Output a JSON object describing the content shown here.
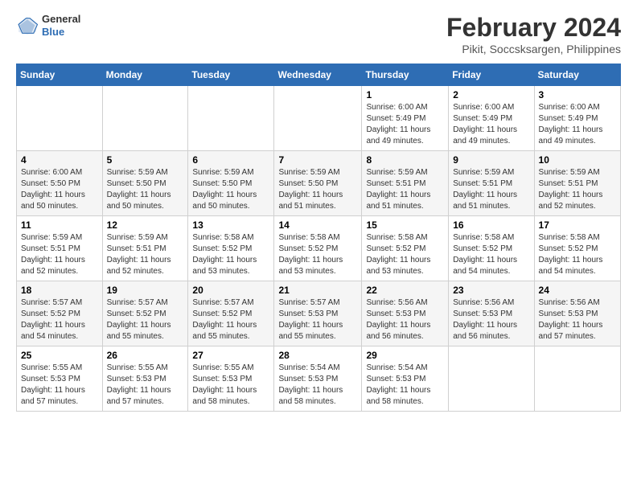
{
  "header": {
    "logo_general": "General",
    "logo_blue": "Blue",
    "month_year": "February 2024",
    "location": "Pikit, Soccsksargen, Philippines"
  },
  "weekdays": [
    "Sunday",
    "Monday",
    "Tuesday",
    "Wednesday",
    "Thursday",
    "Friday",
    "Saturday"
  ],
  "weeks": [
    [
      {
        "day": "",
        "info": ""
      },
      {
        "day": "",
        "info": ""
      },
      {
        "day": "",
        "info": ""
      },
      {
        "day": "",
        "info": ""
      },
      {
        "day": "1",
        "info": "Sunrise: 6:00 AM\nSunset: 5:49 PM\nDaylight: 11 hours\nand 49 minutes."
      },
      {
        "day": "2",
        "info": "Sunrise: 6:00 AM\nSunset: 5:49 PM\nDaylight: 11 hours\nand 49 minutes."
      },
      {
        "day": "3",
        "info": "Sunrise: 6:00 AM\nSunset: 5:49 PM\nDaylight: 11 hours\nand 49 minutes."
      }
    ],
    [
      {
        "day": "4",
        "info": "Sunrise: 6:00 AM\nSunset: 5:50 PM\nDaylight: 11 hours\nand 50 minutes."
      },
      {
        "day": "5",
        "info": "Sunrise: 5:59 AM\nSunset: 5:50 PM\nDaylight: 11 hours\nand 50 minutes."
      },
      {
        "day": "6",
        "info": "Sunrise: 5:59 AM\nSunset: 5:50 PM\nDaylight: 11 hours\nand 50 minutes."
      },
      {
        "day": "7",
        "info": "Sunrise: 5:59 AM\nSunset: 5:50 PM\nDaylight: 11 hours\nand 51 minutes."
      },
      {
        "day": "8",
        "info": "Sunrise: 5:59 AM\nSunset: 5:51 PM\nDaylight: 11 hours\nand 51 minutes."
      },
      {
        "day": "9",
        "info": "Sunrise: 5:59 AM\nSunset: 5:51 PM\nDaylight: 11 hours\nand 51 minutes."
      },
      {
        "day": "10",
        "info": "Sunrise: 5:59 AM\nSunset: 5:51 PM\nDaylight: 11 hours\nand 52 minutes."
      }
    ],
    [
      {
        "day": "11",
        "info": "Sunrise: 5:59 AM\nSunset: 5:51 PM\nDaylight: 11 hours\nand 52 minutes."
      },
      {
        "day": "12",
        "info": "Sunrise: 5:59 AM\nSunset: 5:51 PM\nDaylight: 11 hours\nand 52 minutes."
      },
      {
        "day": "13",
        "info": "Sunrise: 5:58 AM\nSunset: 5:52 PM\nDaylight: 11 hours\nand 53 minutes."
      },
      {
        "day": "14",
        "info": "Sunrise: 5:58 AM\nSunset: 5:52 PM\nDaylight: 11 hours\nand 53 minutes."
      },
      {
        "day": "15",
        "info": "Sunrise: 5:58 AM\nSunset: 5:52 PM\nDaylight: 11 hours\nand 53 minutes."
      },
      {
        "day": "16",
        "info": "Sunrise: 5:58 AM\nSunset: 5:52 PM\nDaylight: 11 hours\nand 54 minutes."
      },
      {
        "day": "17",
        "info": "Sunrise: 5:58 AM\nSunset: 5:52 PM\nDaylight: 11 hours\nand 54 minutes."
      }
    ],
    [
      {
        "day": "18",
        "info": "Sunrise: 5:57 AM\nSunset: 5:52 PM\nDaylight: 11 hours\nand 54 minutes."
      },
      {
        "day": "19",
        "info": "Sunrise: 5:57 AM\nSunset: 5:52 PM\nDaylight: 11 hours\nand 55 minutes."
      },
      {
        "day": "20",
        "info": "Sunrise: 5:57 AM\nSunset: 5:52 PM\nDaylight: 11 hours\nand 55 minutes."
      },
      {
        "day": "21",
        "info": "Sunrise: 5:57 AM\nSunset: 5:53 PM\nDaylight: 11 hours\nand 55 minutes."
      },
      {
        "day": "22",
        "info": "Sunrise: 5:56 AM\nSunset: 5:53 PM\nDaylight: 11 hours\nand 56 minutes."
      },
      {
        "day": "23",
        "info": "Sunrise: 5:56 AM\nSunset: 5:53 PM\nDaylight: 11 hours\nand 56 minutes."
      },
      {
        "day": "24",
        "info": "Sunrise: 5:56 AM\nSunset: 5:53 PM\nDaylight: 11 hours\nand 57 minutes."
      }
    ],
    [
      {
        "day": "25",
        "info": "Sunrise: 5:55 AM\nSunset: 5:53 PM\nDaylight: 11 hours\nand 57 minutes."
      },
      {
        "day": "26",
        "info": "Sunrise: 5:55 AM\nSunset: 5:53 PM\nDaylight: 11 hours\nand 57 minutes."
      },
      {
        "day": "27",
        "info": "Sunrise: 5:55 AM\nSunset: 5:53 PM\nDaylight: 11 hours\nand 58 minutes."
      },
      {
        "day": "28",
        "info": "Sunrise: 5:54 AM\nSunset: 5:53 PM\nDaylight: 11 hours\nand 58 minutes."
      },
      {
        "day": "29",
        "info": "Sunrise: 5:54 AM\nSunset: 5:53 PM\nDaylight: 11 hours\nand 58 minutes."
      },
      {
        "day": "",
        "info": ""
      },
      {
        "day": "",
        "info": ""
      }
    ]
  ]
}
